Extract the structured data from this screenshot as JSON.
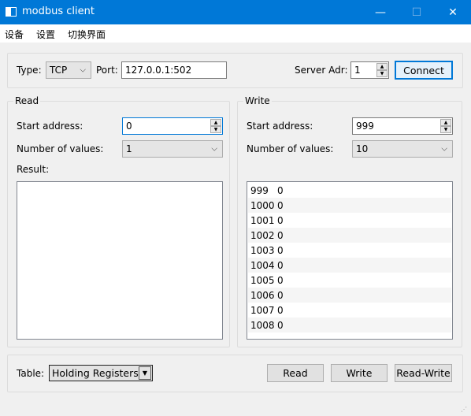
{
  "window": {
    "title": "modbus client",
    "minimize_glyph": "—",
    "maximize_glyph": "☐",
    "close_glyph": "✕"
  },
  "menu": {
    "items": [
      "设备",
      "设置",
      "切换界面"
    ]
  },
  "connection": {
    "type_label": "Type:",
    "type_value": "TCP",
    "port_label": "Port:",
    "port_value": "127.0.0.1:502",
    "server_label": "Server Adr:",
    "server_value": "1",
    "connect_label": "Connect"
  },
  "read": {
    "title": "Read",
    "start_label": "Start address:",
    "start_value": "0",
    "count_label": "Number of values:",
    "count_value": "1",
    "result_label": "Result:"
  },
  "write": {
    "title": "Write",
    "start_label": "Start address:",
    "start_value": "999",
    "count_label": "Number of values:",
    "count_value": "10",
    "rows": [
      {
        "addr": "999",
        "value": "0"
      },
      {
        "addr": "1000",
        "value": "0"
      },
      {
        "addr": "1001",
        "value": "0"
      },
      {
        "addr": "1002",
        "value": "0"
      },
      {
        "addr": "1003",
        "value": "0"
      },
      {
        "addr": "1004",
        "value": "0"
      },
      {
        "addr": "1005",
        "value": "0"
      },
      {
        "addr": "1006",
        "value": "0"
      },
      {
        "addr": "1007",
        "value": "0"
      },
      {
        "addr": "1008",
        "value": "0"
      }
    ]
  },
  "bottom": {
    "table_label": "Table:",
    "table_value": "Holding Registers",
    "read_label": "Read",
    "write_label": "Write",
    "readwrite_label": "Read-Write"
  },
  "icons": {
    "dropdown": "chevron-down-icon",
    "spin": "spin-up-down-icon",
    "app": "window-app-icon"
  },
  "colors": {
    "titlebar": "#0078d7",
    "accent": "#0078d7"
  }
}
